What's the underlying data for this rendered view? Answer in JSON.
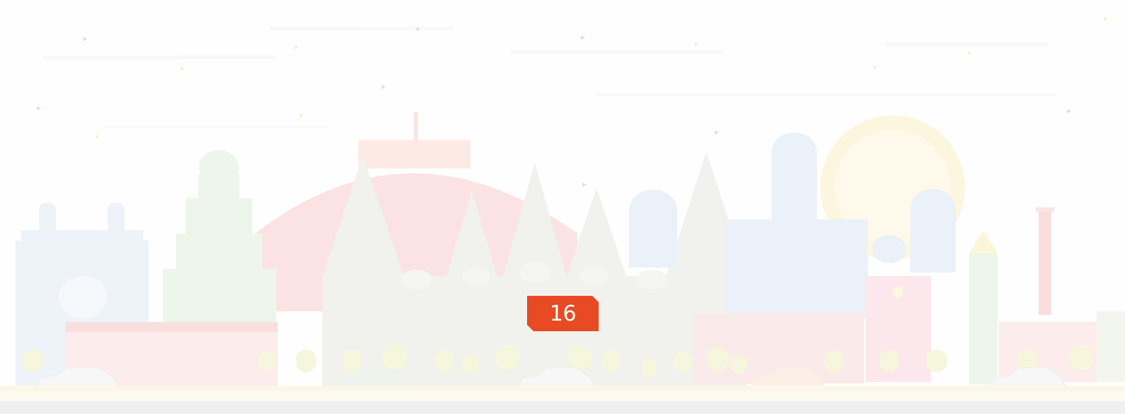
{
  "slide": {
    "number": "16"
  },
  "colors": {
    "badge": "#e84a23",
    "badge_text": "#ffffff",
    "background": "#fefefe",
    "bottom_bar": "#eef0f0"
  },
  "decoration": {
    "name": "faded-india-city-skyline-icon"
  }
}
